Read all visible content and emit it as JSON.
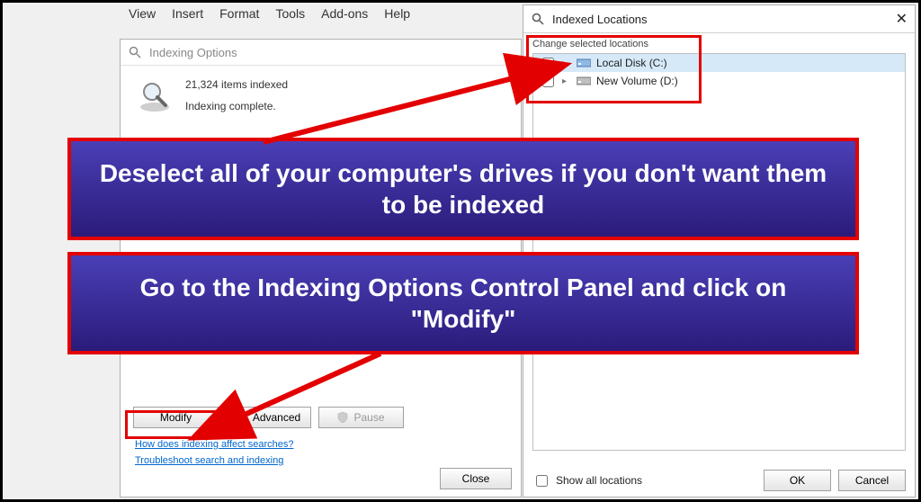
{
  "menubar": [
    "View",
    "Insert",
    "Format",
    "Tools",
    "Add-ons",
    "Help"
  ],
  "indexing": {
    "title": "Indexing Options",
    "items_indexed": "21,324 items indexed",
    "status": "Indexing complete.",
    "buttons": {
      "modify": "Modify",
      "advanced": "Advanced",
      "pause": "Pause",
      "close": "Close"
    },
    "links": {
      "how": "How does indexing affect searches?",
      "troubleshoot": "Troubleshoot search and indexing"
    }
  },
  "locations": {
    "title": "Indexed Locations",
    "group_label": "Change selected locations",
    "drives": [
      {
        "label": "Local Disk (C:)",
        "checked": false,
        "selected": true
      },
      {
        "label": "New Volume (D:)",
        "checked": false,
        "selected": false
      }
    ],
    "show_all": "Show all locations",
    "ok": "OK",
    "cancel": "Cancel"
  },
  "callouts": {
    "c1": "Deselect all of your computer's drives if you don't want them to be indexed",
    "c2": "Go to the Indexing Options Control Panel and click on \"Modify\""
  }
}
